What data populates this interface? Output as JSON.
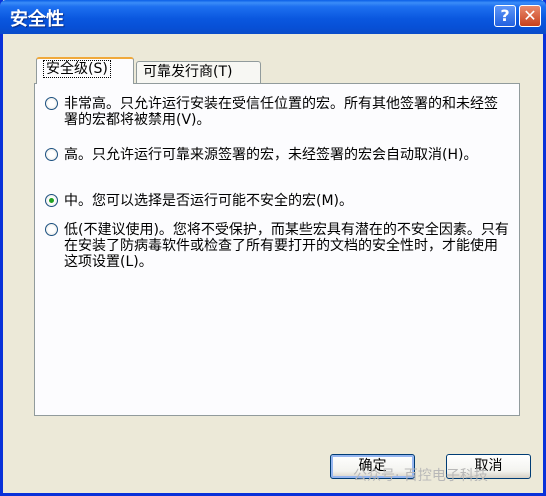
{
  "window": {
    "title": "安全性",
    "help_glyph": "?",
    "close_glyph": "✕"
  },
  "tabs": [
    {
      "label": "安全级(S)",
      "active": true
    },
    {
      "label": "可靠发行商(T)",
      "active": false
    }
  ],
  "options": [
    {
      "text": "非常高。只允许运行安装在受信任位置的宏。所有其他签署的和未经签署的宏都将被禁用(V)。",
      "checked": false
    },
    {
      "text": "高。只允许运行可靠来源签署的宏，未经签署的宏会自动取消(H)。",
      "checked": false
    },
    {
      "text": "中。您可以选择是否运行可能不安全的宏(M)。",
      "checked": true
    },
    {
      "text": "低(不建议使用)。您将不受保护，而某些宏具有潜在的不安全因素。只有在安装了防病毒软件或检查了所有要打开的文档的安全性时，才能使用这项设置(L)。",
      "checked": false
    }
  ],
  "buttons": {
    "ok": "确定",
    "cancel": "取消"
  },
  "watermark": "公众号· 百控电子科技"
}
